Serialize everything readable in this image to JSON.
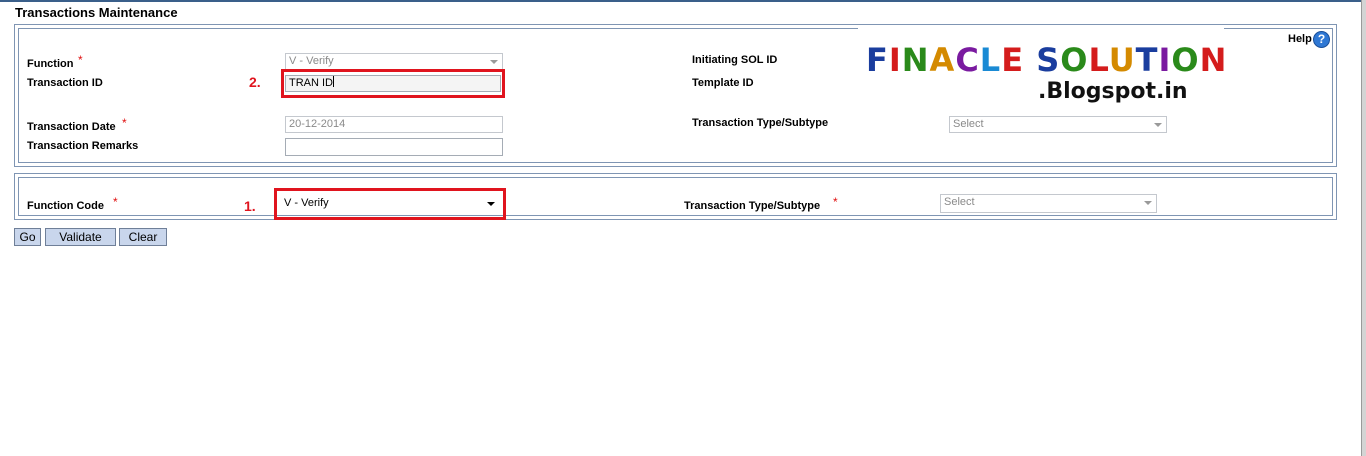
{
  "page_title": "Transactions Maintenance",
  "help": {
    "label": "Help",
    "icon": "question-icon"
  },
  "logo": {
    "line1": "FINACLE SOLUTION",
    "line2": ".Blogspot.in",
    "letter_colors": [
      "#1a3d9e",
      "#d41c1c",
      "#2a8a1a",
      "#d48a00",
      "#7a1aa0",
      "#1a8ad4",
      "#d41c1c",
      "#1a3d9e",
      "#2a8a1a",
      "#d41c1c",
      "#d48a00",
      "#1a3d9e",
      "#7a1aa0",
      "#2a8a1a",
      "#d41c1c",
      "#1a8ad4"
    ]
  },
  "top_form": {
    "function": {
      "label": "Function",
      "required": "*",
      "value": "V - Verify"
    },
    "transaction_id": {
      "label": "Transaction ID",
      "value": "TRAN ID"
    },
    "transaction_date": {
      "label": "Transaction Date",
      "required": "*",
      "value": "20-12-2014"
    },
    "transaction_remarks": {
      "label": "Transaction Remarks",
      "value": ""
    },
    "initiating_sol_id": {
      "label": "Initiating SOL ID"
    },
    "template_id": {
      "label": "Template ID"
    },
    "transaction_type_subtype": {
      "label": "Transaction Type/Subtype",
      "value": "Select"
    }
  },
  "bottom_form": {
    "function_code": {
      "label": "Function Code",
      "required": "*",
      "value": "V - Verify"
    },
    "transaction_type_subtype": {
      "label": "Transaction Type/Subtype",
      "required": "*",
      "value": "Select"
    }
  },
  "annotations": {
    "step1": "1.",
    "step2": "2."
  },
  "buttons": {
    "go": "Go",
    "validate": "Validate",
    "clear": "Clear"
  },
  "colors": {
    "annotation_red": "#e0141e",
    "button_bg": "#c9d6ec",
    "panel_border": "#7f95b3",
    "required": "#e01010"
  }
}
